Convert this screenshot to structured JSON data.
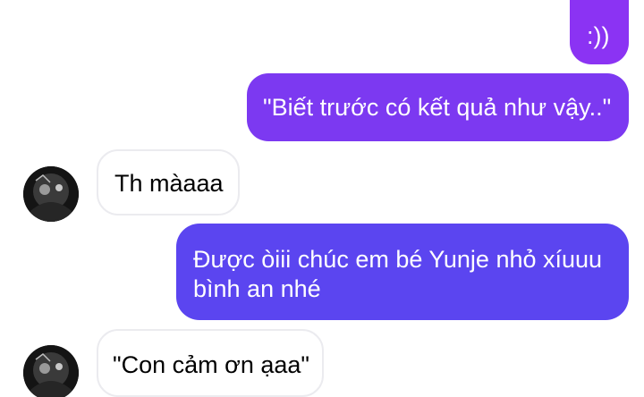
{
  "conversation": {
    "messages": [
      {
        "sender": "me",
        "text": ":))"
      },
      {
        "sender": "me",
        "text": "\"Biết trước có kết quả như vậy..\""
      },
      {
        "sender": "contact",
        "text": "Th màaaa"
      },
      {
        "sender": "me",
        "text": "Được òiii chúc em bé Yunje nhỏ xíuuu bình an nhé"
      },
      {
        "sender": "contact",
        "text": "\"Con cảm ơn ạaa\""
      }
    ]
  },
  "colors": {
    "outgoing_bubble_top": "#8a35f2",
    "outgoing_bubble_bottom": "#5a45f0",
    "incoming_bubble_bg": "#ffffff",
    "incoming_bubble_border": "#e8e8ec",
    "avatar_bg": "#1a1a1a"
  },
  "icons": {
    "avatar": "contact-avatar-photo"
  }
}
